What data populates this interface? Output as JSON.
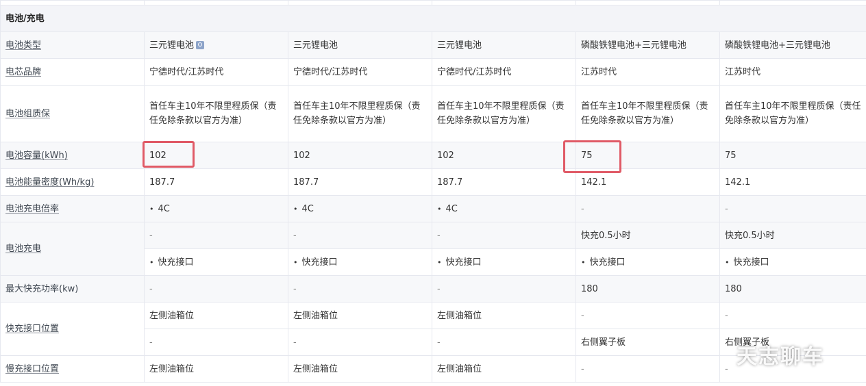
{
  "section_title": "电池/充电",
  "rows": {
    "battery_type": {
      "label": "电池类型",
      "values": [
        "三元锂电池",
        "三元锂电池",
        "三元锂电池",
        "磷酸铁锂电池+三元锂电池",
        "磷酸铁锂电池+三元锂电池"
      ]
    },
    "cell_brand": {
      "label": "电芯品牌",
      "values": [
        "宁德时代/江苏时代",
        "宁德时代/江苏时代",
        "宁德时代/江苏时代",
        "江苏时代",
        "江苏时代"
      ]
    },
    "warranty": {
      "label": "电池组质保",
      "values": [
        "首任车主10年不限里程质保（责任免除条款以官方为准）",
        "首任车主10年不限里程质保（责任免除条款以官方为准）",
        "首任车主10年不限里程质保（责任免除条款以官方为准）",
        "首任车主10年不限里程质保（责任免除条款以官方为准）",
        "首任车主10年不限里程质保（责任免除条款以官方为准）"
      ]
    },
    "capacity": {
      "label": "电池容量(kWh)",
      "values": [
        "102",
        "102",
        "102",
        "75",
        "75"
      ]
    },
    "energy_density": {
      "label": "电池能量密度(Wh/kg)",
      "values": [
        "187.7",
        "187.7",
        "187.7",
        "142.1",
        "142.1"
      ]
    },
    "charge_rate": {
      "label": "电池充电倍率",
      "values": [
        "4C",
        "4C",
        "4C",
        "-",
        "-"
      ]
    },
    "charging": {
      "label": "电池充电",
      "line1": [
        "-",
        "-",
        "-",
        "快充0.5小时",
        "快充0.5小时"
      ],
      "line2": [
        "快充接口",
        "快充接口",
        "快充接口",
        "快充接口",
        "快充接口"
      ]
    },
    "max_fast_power": {
      "label": "最大快充功率(kw)",
      "values": [
        "-",
        "-",
        "-",
        "180",
        "180"
      ]
    },
    "fast_port_position": {
      "label": "快充接口位置",
      "line1": [
        "左侧油箱位",
        "左侧油箱位",
        "左侧油箱位",
        "-",
        "-"
      ],
      "line2": [
        "-",
        "-",
        "-",
        "右侧翼子板",
        "右侧翼子板"
      ]
    },
    "slow_port_position": {
      "label": "慢充接口位置",
      "values": [
        "左侧油箱位",
        "左侧油箱位",
        "左侧油箱位",
        "-",
        "-"
      ]
    }
  },
  "watermark": "天志聊车",
  "accent_color": "#e05a66"
}
